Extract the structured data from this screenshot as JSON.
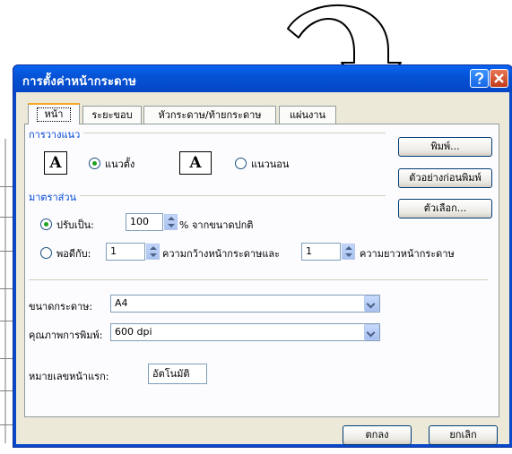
{
  "window": {
    "title": "การตั้งค่าหน้ากระดาษ"
  },
  "tabs": [
    {
      "label": "หน้า",
      "active": true
    },
    {
      "label": "ระยะขอบ"
    },
    {
      "label": "หัวกระดาษ/ท้ายกระดาษ"
    },
    {
      "label": "แผ่นงาน"
    }
  ],
  "orientation": {
    "group_label": "การวางแนว",
    "portrait_label": "แนวตั้ง",
    "landscape_label": "แนวนอน",
    "icon_glyph": "A",
    "selected": "portrait"
  },
  "scaling": {
    "group_label": "มาตราส่วน",
    "adjust_label": "ปรับเป็น:",
    "adjust_value": "100",
    "adjust_suffix": "% จากขนาดปกติ",
    "fit_label": "พอดีกับ:",
    "fit_wide_value": "1",
    "fit_wide_suffix": "ความกว้างหน้ากระดาษและ",
    "fit_tall_value": "1",
    "fit_tall_suffix": "ความยาวหน้ากระดาษ",
    "selected": "adjust"
  },
  "paper_size": {
    "label": "ขนาดกระดาษ:",
    "value": "A4"
  },
  "print_quality": {
    "label": "คุณภาพการพิมพ์:",
    "value": "600 dpi"
  },
  "first_page_number": {
    "label": "หมายเลขหน้าแรก:",
    "value": "อัตโนมัติ"
  },
  "side_buttons": {
    "print": "พิมพ์...",
    "print_preview": "ตัวอย่างก่อนพิมพ์",
    "options": "ตัวเลือก..."
  },
  "footer_buttons": {
    "ok": "ตกลง",
    "cancel": "ยกเลิก"
  },
  "icons": {
    "help": "question-mark",
    "close": "x",
    "annotation": "curved-arrow"
  },
  "colors": {
    "title_bar": "#0553d6",
    "close_button": "#d9502c",
    "group_label": "#0046d5",
    "radio_dot": "#21a121",
    "active_tab_accent": "#f5a623"
  }
}
